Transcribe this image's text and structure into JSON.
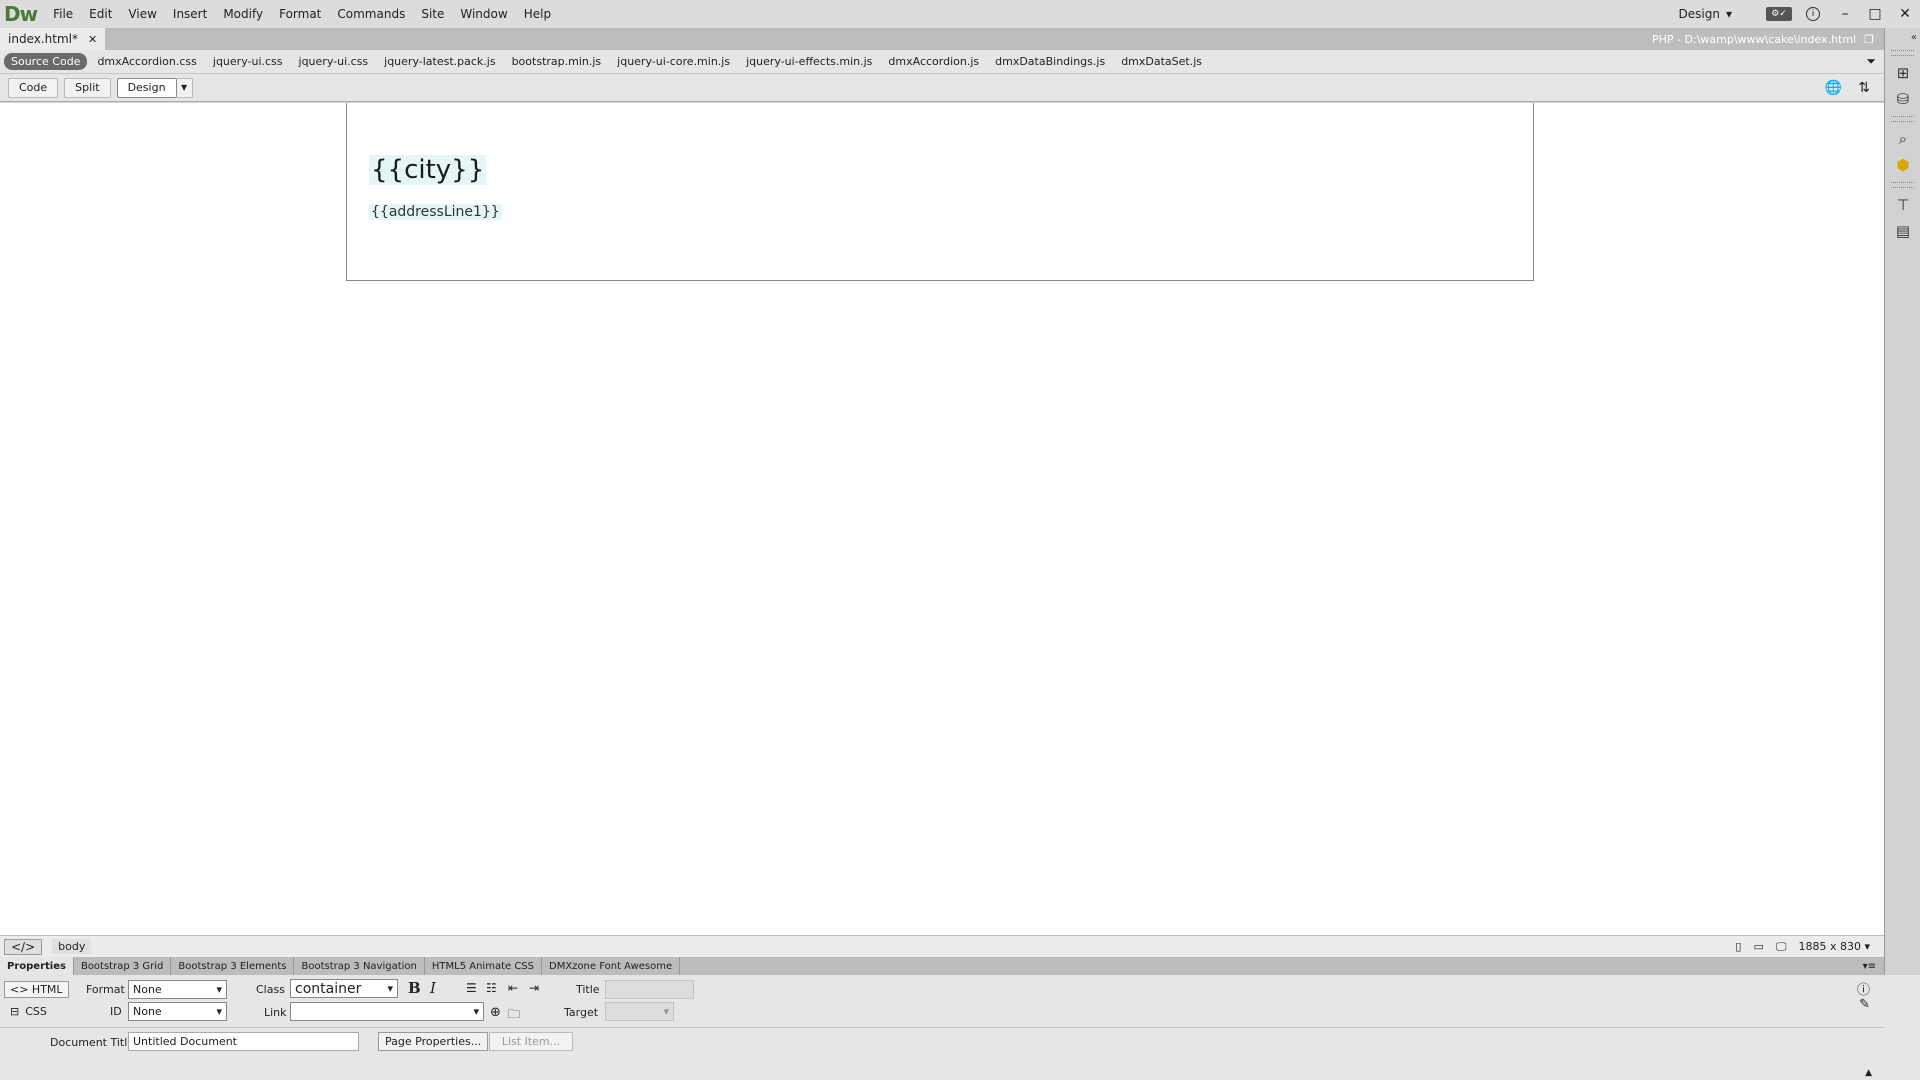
{
  "app": {
    "logo": "Dw",
    "menu": [
      "File",
      "Edit",
      "View",
      "Insert",
      "Modify",
      "Format",
      "Commands",
      "Site",
      "Window",
      "Help"
    ],
    "workspace": "Design",
    "window_controls": [
      "minimize",
      "maximize",
      "close"
    ]
  },
  "document": {
    "tab_label": "index.html*",
    "path": "PHP - D:\\wamp\\www\\cake\\index.html"
  },
  "related_files": [
    "Source Code",
    "dmxAccordion.css",
    "jquery-ui.css",
    "jquery-ui.css",
    "jquery-latest.pack.js",
    "bootstrap.min.js",
    "jquery-ui-core.min.js",
    "jquery-ui-effects.min.js",
    "dmxAccordion.js",
    "dmxDataBindings.js",
    "dmxDataSet.js"
  ],
  "view_modes": {
    "code": "Code",
    "split": "Split",
    "design": "Design"
  },
  "canvas": {
    "city": "{{city}}",
    "address": "{{addressLine1}}"
  },
  "status": {
    "tag_toggle": "</>",
    "tag_body": "body",
    "window_size": "1885 x 830 ▾"
  },
  "panel_tabs": [
    "Properties",
    "Bootstrap 3 Grid",
    "Bootstrap 3 Elements",
    "Bootstrap 3 Navigation",
    "HTML5 Animate CSS",
    "DMXzone Font Awesome"
  ],
  "properties": {
    "mode_html": "<> HTML",
    "mode_css": "CSS",
    "format_label": "Format",
    "format_value": "None",
    "id_label": "ID",
    "id_value": "None",
    "class_label": "Class",
    "class_value": "container",
    "link_label": "Link",
    "link_value": "",
    "title_label": "Title",
    "target_label": "Target",
    "bold": "B",
    "italic": "I",
    "doc_title_label": "Document Title",
    "doc_title_value": "Untitled Document",
    "page_properties": "Page Properties...",
    "list_item": "List Item..."
  }
}
